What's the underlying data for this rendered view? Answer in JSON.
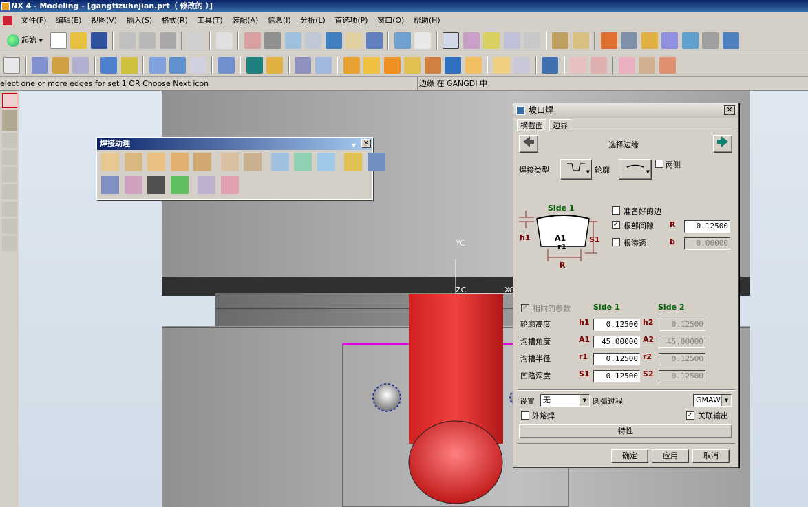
{
  "window": {
    "title": "NX 4 - Modeling - [gangtizuhejian.prt（ 修改的 ）]"
  },
  "menu": {
    "items": [
      "文件(F)",
      "编辑(E)",
      "视图(V)",
      "插入(S)",
      "格式(R)",
      "工具(T)",
      "装配(A)",
      "信息(I)",
      "分析(L)",
      "首选项(P)",
      "窗口(O)",
      "帮助(H)"
    ]
  },
  "toolbar": {
    "start_label": "起始"
  },
  "status": {
    "prompt": "elect one or more edges for set  1  OR Choose Next icon",
    "message": "边缘 在 GANGDI 中"
  },
  "viewport": {
    "axis_yc": "YC",
    "axis_zc": "ZC",
    "axis_xc": "XC"
  },
  "palette": {
    "title": "焊接助理"
  },
  "dialog": {
    "title": "坡口焊",
    "tabs": [
      "横截面",
      "边界"
    ],
    "select_edges": "选择边缘",
    "weld_type_label": "焊接类型",
    "contour_label": "轮廓",
    "both_sides": {
      "label": "两侧",
      "checked": false
    },
    "diagram": {
      "side1": "Side 1",
      "h1": "h1",
      "a1": "A1",
      "r1": "r1",
      "s1": "S1",
      "r": "R"
    },
    "prepared_edge": {
      "label": "准备好的边",
      "checked": false
    },
    "root_gap": {
      "label": "根部间隙",
      "checked": true,
      "symbol": "R",
      "value": "0.12500"
    },
    "root_penetration": {
      "label": "根渗透",
      "checked": false,
      "symbol": "b",
      "value": "0.00000"
    },
    "same_params": {
      "label": "相同的参数",
      "checked": true
    },
    "side1_header": "Side 1",
    "side2_header": "Side 2",
    "params": [
      {
        "label": "轮廓高度",
        "s1": "h1",
        "v1": "0.12500",
        "s2": "h2",
        "v2": "0.12500"
      },
      {
        "label": "沟槽角度",
        "s1": "A1",
        "v1": "45.00000",
        "s2": "A2",
        "v2": "45.00000"
      },
      {
        "label": "沟槽半径",
        "s1": "r1",
        "v1": "0.12500",
        "s2": "r2",
        "v2": "0.12500"
      },
      {
        "label": "凹陷深度",
        "s1": "S1",
        "v1": "0.12500",
        "s2": "S2",
        "v2": "0.12500"
      }
    ],
    "settings_label": "设置",
    "settings_value": "无",
    "arc_process_label": "圆弧过程",
    "arc_process_value": "GMAW",
    "outer_weld": {
      "label": "外熔焊",
      "checked": false
    },
    "associative_output": {
      "label": "关联输出",
      "checked": true
    },
    "properties_button": "特性",
    "ok": "确定",
    "apply": "应用",
    "cancel": "取消"
  }
}
